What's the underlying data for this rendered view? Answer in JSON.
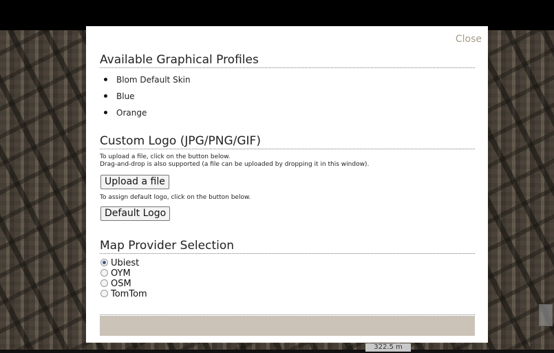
{
  "dialog": {
    "close_label": "Close",
    "profiles": {
      "title": "Available Graphical Profiles",
      "items": [
        "Blom Default Skin",
        "Blue",
        "Orange"
      ]
    },
    "logo": {
      "title": "Custom Logo (JPG/PNG/GIF)",
      "upload_hint_line1": "To upload a file, click on the button below.",
      "upload_hint_line2": "Drag-and-drop is also supported (a file can be uploaded by dropping it in this window).",
      "upload_button": "Upload a file",
      "default_hint": "To assign default logo, click on the button below.",
      "default_button": "Default Logo"
    },
    "provider": {
      "title": "Map Provider Selection",
      "selected": "Ubiest",
      "options": [
        "Ubiest",
        "OYM",
        "OSM",
        "TomTom"
      ]
    }
  },
  "map": {
    "scale_label": "322.5 m"
  },
  "colors": {
    "close_text": "#a79a88",
    "footer_bar": "#cbc3b7",
    "backdrop": "#000000"
  }
}
